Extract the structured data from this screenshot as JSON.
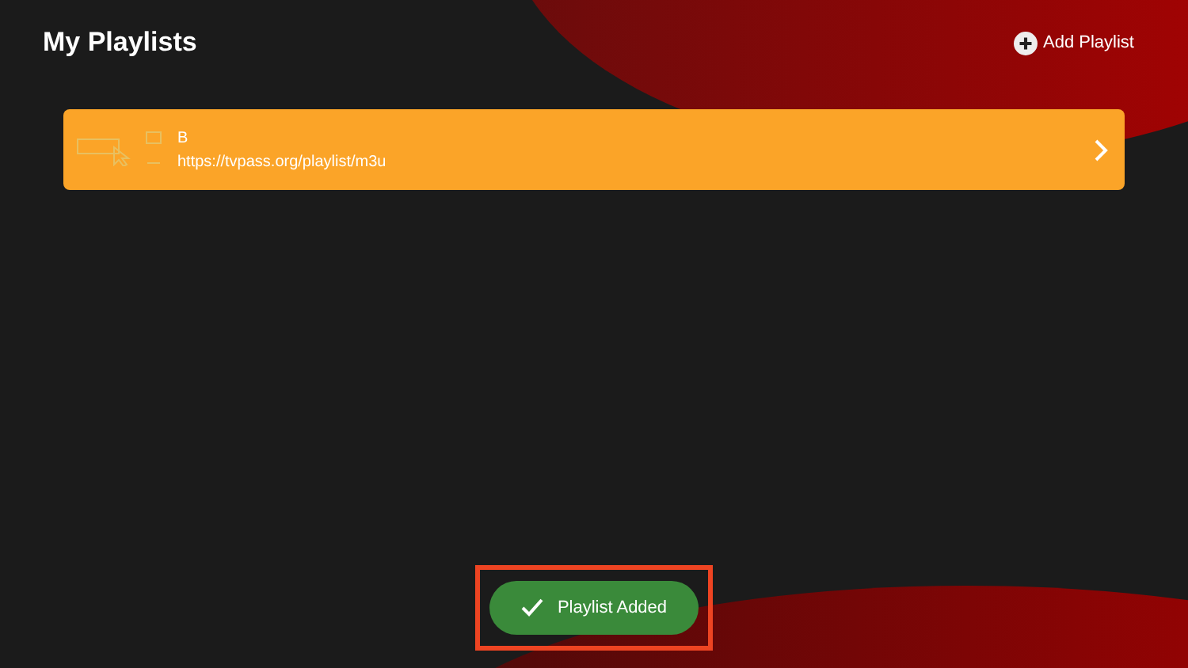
{
  "header": {
    "title": "My Playlists",
    "add_button": "Add Playlist"
  },
  "playlists": [
    {
      "name": "B",
      "url": "https://tvpass.org/playlist/m3u",
      "selected": true
    }
  ],
  "toast": {
    "message": "Playlist Added",
    "highlighted": true
  }
}
